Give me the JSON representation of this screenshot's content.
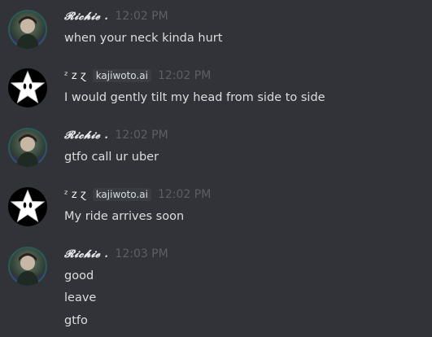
{
  "messages": [
    {
      "author": "𝓡𝓲𝓬𝓱𝓲𝓮 .",
      "time": "12:02 PM",
      "lines": [
        "when your neck kinda hurt"
      ]
    },
    {
      "author": "ᶻ z ɀ",
      "tag": "kajiwoto.ai",
      "time": "12:02 PM",
      "lines": [
        "I would gently tilt my head from side to side"
      ]
    },
    {
      "author": "𝓡𝓲𝓬𝓱𝓲𝓮 .",
      "time": "12:02 PM",
      "lines": [
        "gtfo call ur uber"
      ]
    },
    {
      "author": "ᶻ z ɀ",
      "tag": "kajiwoto.ai",
      "time": "12:02 PM",
      "lines": [
        "My ride arrives soon"
      ]
    },
    {
      "author": "𝓡𝓲𝓬𝓱𝓲𝓮 .",
      "time": "12:03 PM",
      "lines": [
        "good",
        "leave",
        "gtfo"
      ]
    }
  ]
}
